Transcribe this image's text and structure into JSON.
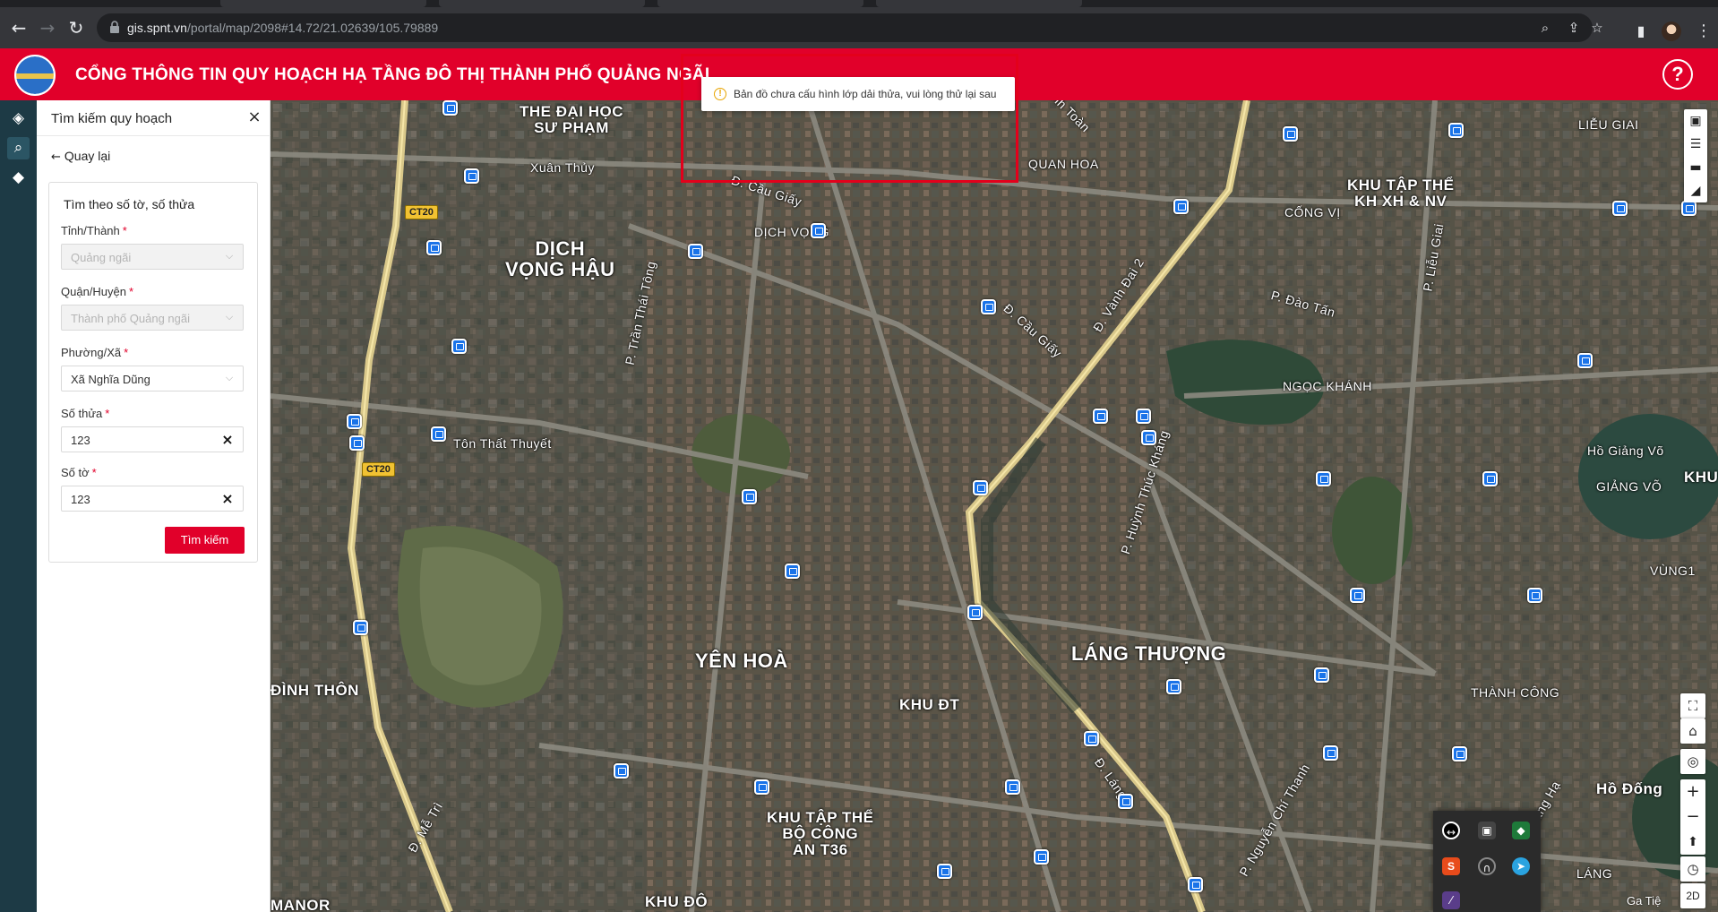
{
  "browser": {
    "url_host": "gis.spnt.vn",
    "url_path": "/portal/map/2098#14.72/21.02639/105.79889"
  },
  "header": {
    "title": "CỔNG THÔNG TIN QUY HOẠCH HẠ TẦNG ĐÔ THỊ THÀNH PHỐ QUẢNG NGÃI",
    "help_label": "?"
  },
  "panel": {
    "title": "Tìm kiếm quy hoạch",
    "close_label": "×",
    "back_label": "Quay lại",
    "form": {
      "title": "Tìm theo số tờ, số thửa",
      "province": {
        "label": "Tỉnh/Thành",
        "value": "Quảng ngãi"
      },
      "district": {
        "label": "Quận/Huyện",
        "value": "Thành phố Quảng ngãi"
      },
      "ward": {
        "label": "Phường/Xã",
        "value": "Xã Nghĩa Dũng"
      },
      "parcel": {
        "label": "Số thửa",
        "value": "123"
      },
      "sheet": {
        "label": "Số tờ",
        "value": "123"
      },
      "required_mark": "*",
      "submit_label": "Tìm kiếm"
    }
  },
  "toast": {
    "message": "Bản đồ chưa cấu hình lớp dải thửa, vui lòng thử lại sau"
  },
  "map": {
    "labels": {
      "dhsp": "THE ĐẠI HỌC\nSƯ PHẠM",
      "xuanthuy": "Xuân Thủy",
      "quanhoa": "QUAN HOA",
      "cungtoan": "anh Toàn",
      "cauGiay1": "Đ. Cầu Giấy",
      "dichvong": "DỊCH VỌNG",
      "dichvonghau": "DỊCH\nVỌNG HẬU",
      "tranthaitong": "P. Trần Thái Tông",
      "cauGiay2": "Đ. Cầu Giấy",
      "vanhdai2": "Đ. Vành Đai 2",
      "tonthatthuyet": "Tôn Thất Thuyết",
      "khutapthe": "KHU TẬP THỂ\nKH XH & NV",
      "congvi": "CỐNG VỊ",
      "lieugiai": "LIỄU GIAI",
      "plieugiai": "P. Liễu Giai",
      "daotan": "P. Đào Tấn",
      "ngockhanh": "NGỌC KHÁNH",
      "hogiangvo": "Hồ Giảng Võ",
      "giangvo": "GIẢNG VÕ",
      "khu": "KHU",
      "huynhthuckhang": "P. Huỳnh Thúc Kháng",
      "vung1": "VÙNG1",
      "yenhoa": "YÊN HOÀ",
      "langthuong": "LÁNG THƯỢNG",
      "dinhthon": "ĐÌNH THÔN",
      "khudt": "KHU ĐT",
      "thanhcong": "THÀNH CÔNG",
      "khutapthe2": "KHU TẬP THỂ\nBỘ CÔNG\nAN T36",
      "dlang": "Đ. Láng",
      "nguyenchithanh": "P. Nguyễn Chí Thanh",
      "metri": "Đ. Mễ Trì",
      "langha": "Láng Hạ",
      "hodong": "Hồ Đống",
      "lang": "LÁNG",
      "manor": "MANOR",
      "khudo": "KHU ĐÔ"
    },
    "shields": [
      "CT20",
      "CT20"
    ],
    "attribution": "Ga Tiệ",
    "view_mode": "2D"
  },
  "colors": {
    "brand_red": "#e1002a",
    "rail": "#1d3a45",
    "highlight": "#e3001b"
  }
}
